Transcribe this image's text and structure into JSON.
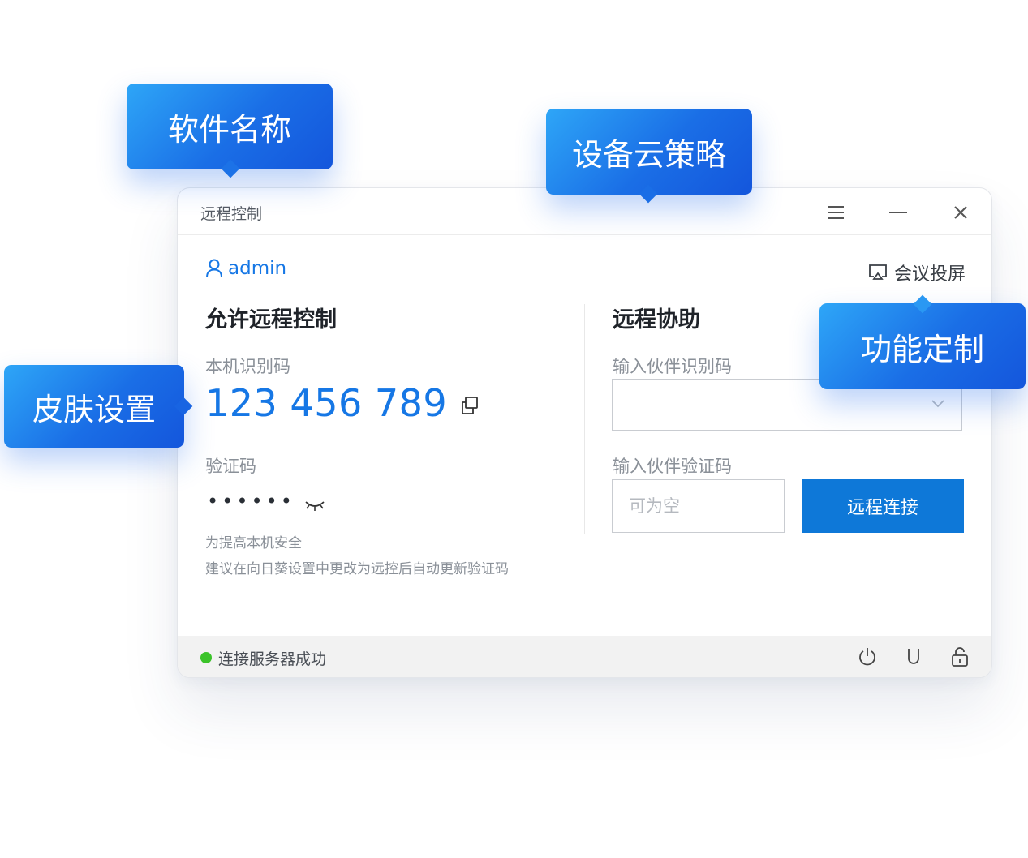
{
  "window": {
    "title": "远程控制"
  },
  "left_panel": {
    "username": "admin",
    "section_title": "允许远程控制",
    "device_id_label": "本机识别码",
    "device_id": "123 456 789",
    "code_label": "验证码",
    "code_masked": "••••••",
    "tip_line1": "为提高本机安全",
    "tip_line2": "建议在向日葵设置中更改为远控后自动更新验证码"
  },
  "right_panel": {
    "cast_label": "会议投屏",
    "section_title": "远程协助",
    "partner_id_label": "输入伙伴识别码",
    "partner_id_value": "",
    "partner_code_label": "输入伙伴验证码",
    "partner_code_placeholder": "可为空",
    "connect_label": "远程连接"
  },
  "statusbar": {
    "status_text": "连接服务器成功",
    "icons": [
      "power-icon",
      "usb-icon",
      "lock-icon"
    ]
  },
  "callouts": {
    "software_name": "软件名称",
    "device_cloud_policy": "设备云策略",
    "skin_settings": "皮肤设置",
    "feature_custom": "功能定制"
  },
  "colors": {
    "accent": "#1677e5",
    "button": "#0e78d8",
    "status_ok": "#3bc32a",
    "callout_start": "#2ea6f7",
    "callout_end": "#1456dc"
  }
}
